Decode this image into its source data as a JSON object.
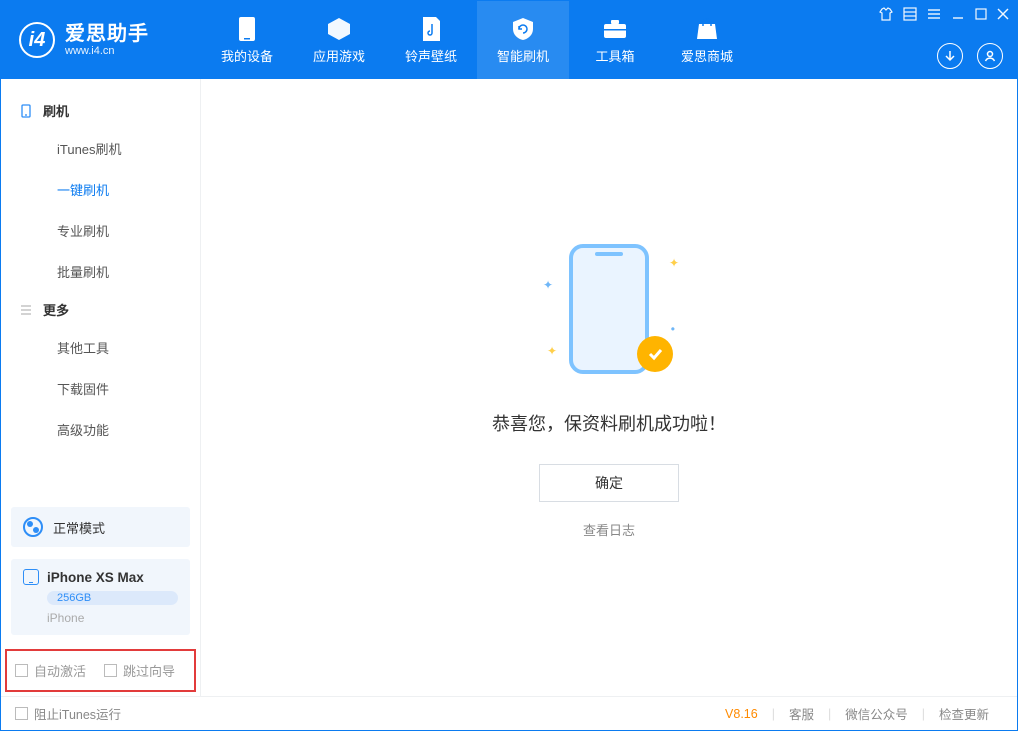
{
  "app": {
    "title": "爱思助手",
    "subtitle": "www.i4.cn"
  },
  "nav": {
    "items": [
      {
        "label": "我的设备"
      },
      {
        "label": "应用游戏"
      },
      {
        "label": "铃声壁纸"
      },
      {
        "label": "智能刷机"
      },
      {
        "label": "工具箱"
      },
      {
        "label": "爱思商城"
      }
    ]
  },
  "sidebar": {
    "section1": {
      "title": "刷机",
      "items": [
        {
          "label": "iTunes刷机"
        },
        {
          "label": "一键刷机"
        },
        {
          "label": "专业刷机"
        },
        {
          "label": "批量刷机"
        }
      ]
    },
    "section2": {
      "title": "更多",
      "items": [
        {
          "label": "其他工具"
        },
        {
          "label": "下载固件"
        },
        {
          "label": "高级功能"
        }
      ]
    },
    "mode_label": "正常模式",
    "device": {
      "name": "iPhone XS Max",
      "capacity": "256GB",
      "type": "iPhone"
    },
    "options": {
      "auto_activate": "自动激活",
      "skip_guide": "跳过向导"
    }
  },
  "main": {
    "success_message": "恭喜您，保资料刷机成功啦！",
    "ok_button": "确定",
    "view_log": "查看日志"
  },
  "statusbar": {
    "block_itunes": "阻止iTunes运行",
    "version": "V8.16",
    "links": {
      "support": "客服",
      "wechat": "微信公众号",
      "check_update": "检查更新"
    }
  }
}
